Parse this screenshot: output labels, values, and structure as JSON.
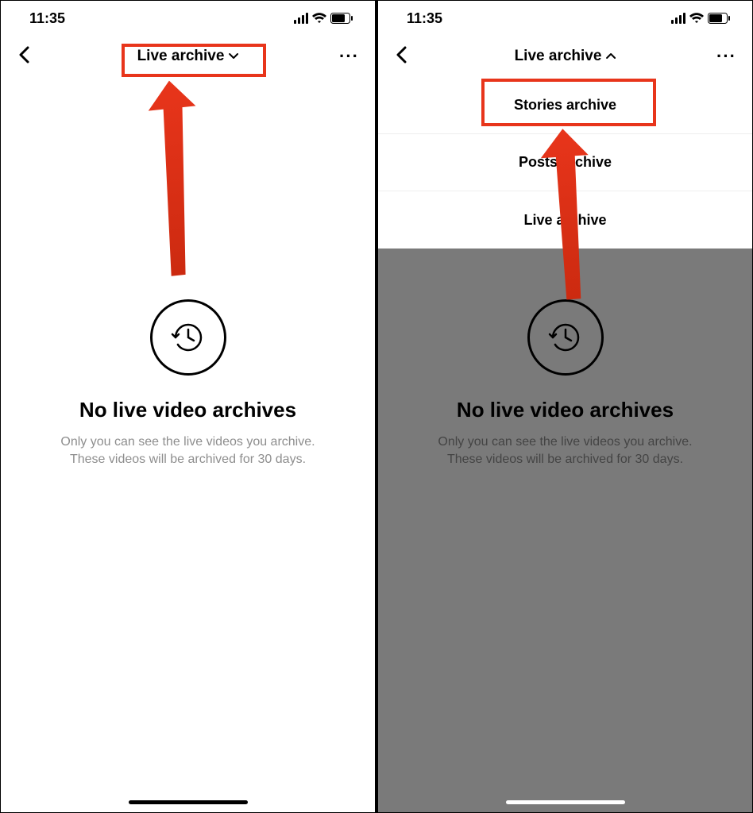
{
  "left": {
    "time": "11:35",
    "header_title": "Live archive",
    "empty_title": "No live video archives",
    "empty_sub1": "Only you can see the live videos you archive.",
    "empty_sub2": "These videos will be archived for 30 days."
  },
  "right": {
    "time": "11:35",
    "header_title": "Live archive",
    "empty_title": "No live video archives",
    "empty_sub1": "Only you can see the live videos you archive.",
    "empty_sub2": "These videos will be archived for 30 days.",
    "dropdown": {
      "item1": "Stories archive",
      "item2": "Posts archive",
      "item3": "Live archive"
    }
  },
  "annotation_color": "#e8351b"
}
